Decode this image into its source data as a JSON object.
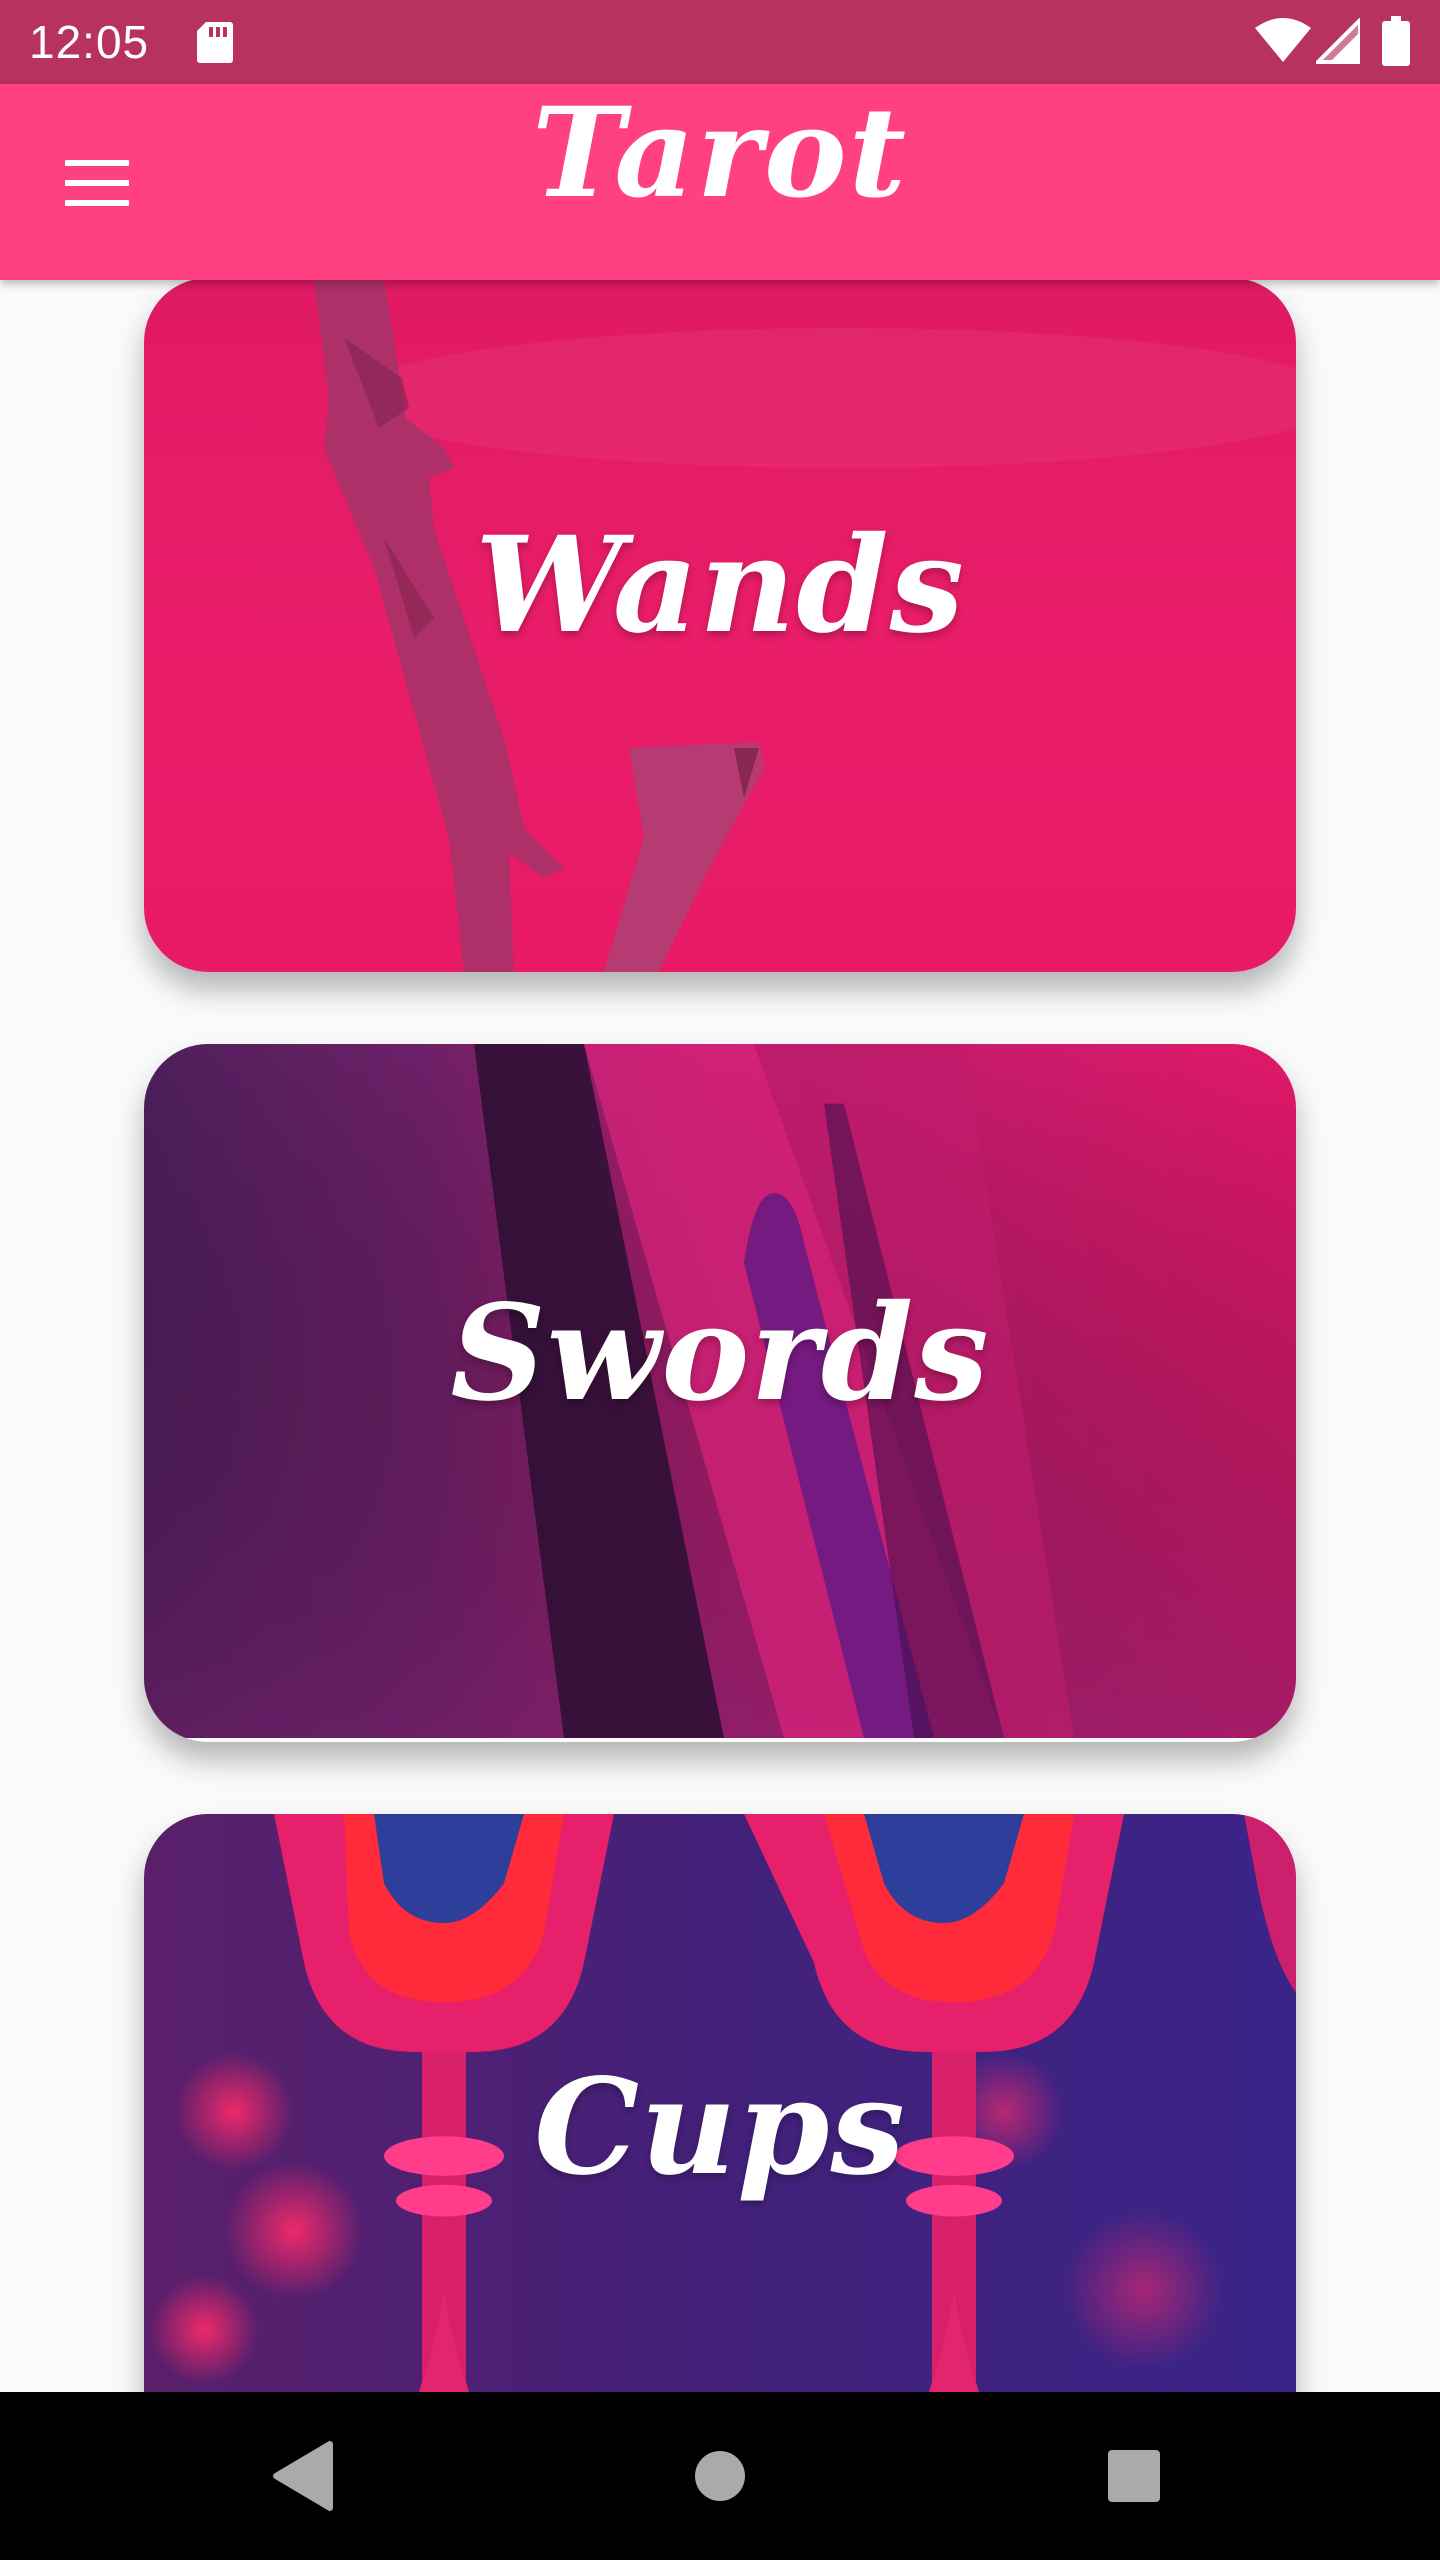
{
  "status_bar": {
    "time": "12:05",
    "icons": [
      "sd-card-icon",
      "wifi-icon",
      "cell-signal-icon",
      "battery-icon"
    ]
  },
  "app_bar": {
    "title": "Tarot",
    "menu_icon": "menu-icon",
    "color": "#ff4181"
  },
  "cards": [
    {
      "label": "Wands",
      "tint": "#e8196a"
    },
    {
      "label": "Swords",
      "tint": "#8a1f6e"
    },
    {
      "label": "Cups",
      "tint": "#c2236f"
    }
  ],
  "nav_bar": {
    "icons": [
      "back-icon",
      "home-icon",
      "recents-icon"
    ]
  },
  "colors": {
    "status_bar": "#b8325f",
    "background": "#fafafa",
    "nav_bar": "#000000"
  }
}
